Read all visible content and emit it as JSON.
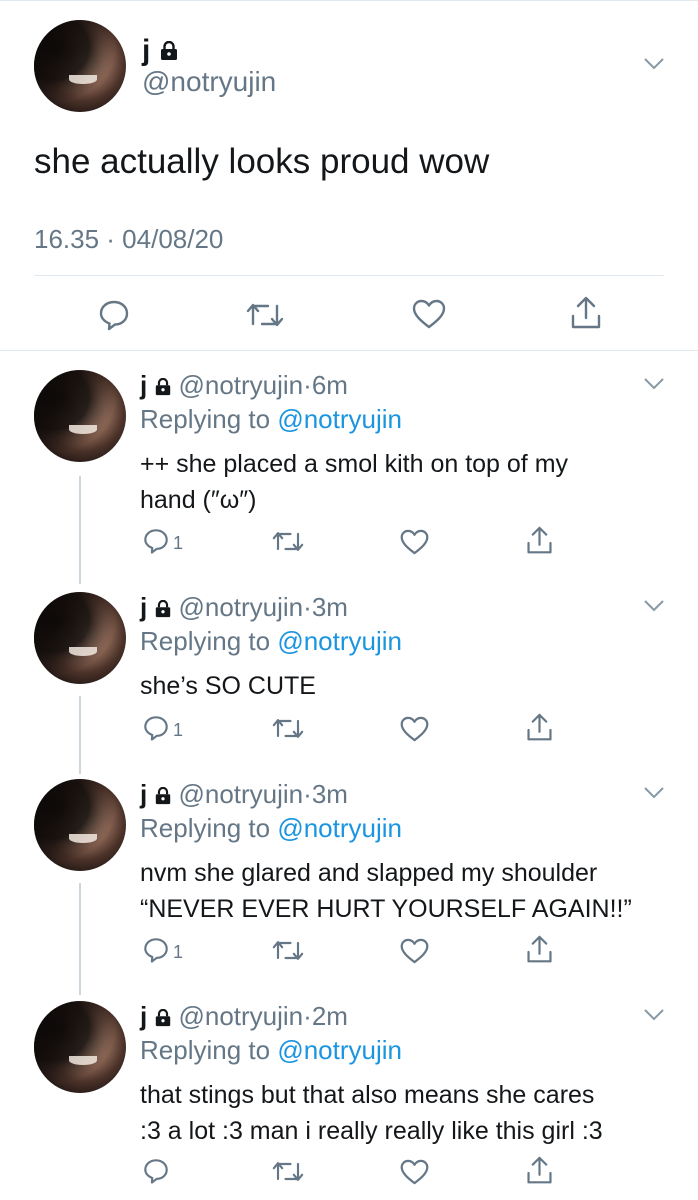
{
  "main_tweet": {
    "display_name": "j",
    "handle": "@notryujin",
    "text": "she actually looks proud wow",
    "timestamp": "16.35 · 04/08/20",
    "actions": [
      "reply-icon",
      "retweet-icon",
      "like-icon",
      "share-icon"
    ]
  },
  "replies": [
    {
      "display_name": "j",
      "handle": "@notryujin",
      "time": "6m",
      "replying_label": "Replying to",
      "replying_to": "@notryujin",
      "lines": [
        "++ she placed a smol kith on top of my",
        "hand (″ω″)"
      ],
      "reply_count": "1"
    },
    {
      "display_name": "j",
      "handle": "@notryujin",
      "time": "3m",
      "replying_label": "Replying to",
      "replying_to": "@notryujin",
      "lines": [
        "she’s SO CUTE"
      ],
      "reply_count": "1"
    },
    {
      "display_name": "j",
      "handle": "@notryujin",
      "time": "3m",
      "replying_label": "Replying to",
      "replying_to": "@notryujin",
      "lines": [
        "nvm she glared and slapped my shoulder",
        "“NEVER EVER HURT YOURSELF AGAIN!!”"
      ],
      "reply_count": "1"
    },
    {
      "display_name": "j",
      "handle": "@notryujin",
      "time": "2m",
      "replying_label": "Replying to",
      "replying_to": "@notryujin",
      "lines": [
        "that stings but that also means she cares",
        ":3 a lot :3 man i really really like this girl :3"
      ],
      "reply_count": ""
    }
  ],
  "colors": {
    "link": "#1b95e0",
    "secondary": "#657786",
    "divider": "#e1e8ed",
    "thread_line": "#ccd6dd"
  }
}
